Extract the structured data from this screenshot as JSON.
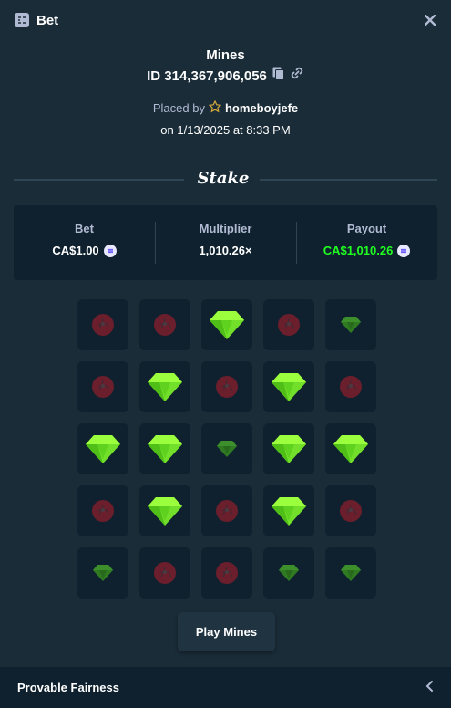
{
  "header": {
    "title": "Bet",
    "icon": "bet-slip-icon",
    "close_icon": "close-icon"
  },
  "bet": {
    "game": "Mines",
    "id_text": "ID 314,367,906,056",
    "placed_by_label": "Placed by",
    "username": "homeboyjefe",
    "date_text": "on 1/13/2025 at 8:33 PM"
  },
  "brand": {
    "name": "Stake"
  },
  "stats": {
    "bet_label": "Bet",
    "bet_value": "CA$1.00",
    "multiplier_label": "Multiplier",
    "multiplier_value": "1,010.26×",
    "payout_label": "Payout",
    "payout_value": "CA$1,010.26"
  },
  "colors": {
    "background": "#1a2c38",
    "panel": "#0f212e",
    "accent_green": "#1fff20",
    "text_muted": "#b1bad3"
  },
  "board": {
    "legend": {
      "G": "gem-revealed",
      "g": "gem-unrevealed",
      "M": "mine-unrevealed"
    },
    "tiles": [
      [
        "M",
        "M",
        "G",
        "M",
        "g"
      ],
      [
        "M",
        "G",
        "M",
        "G",
        "M"
      ],
      [
        "G",
        "G",
        "g",
        "G",
        "G"
      ],
      [
        "M",
        "G",
        "M",
        "G",
        "M"
      ],
      [
        "g",
        "M",
        "M",
        "g",
        "g"
      ]
    ]
  },
  "play_button": {
    "label": "Play Mines"
  },
  "footer": {
    "title": "Provable Fairness",
    "icon": "chevron-left-icon"
  }
}
